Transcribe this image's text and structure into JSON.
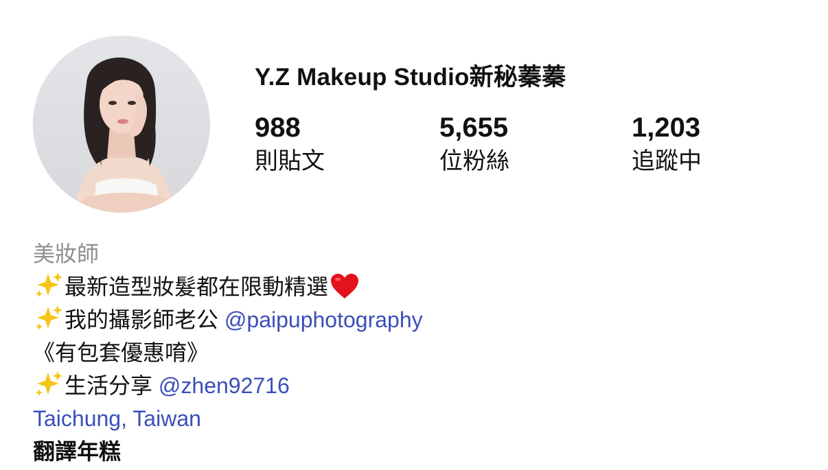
{
  "profile": {
    "username": "Y.Z Makeup Studio新秘蓁蓁",
    "avatar_icon": "profile-photo"
  },
  "stats": {
    "posts": {
      "count": "988",
      "label": "則貼文"
    },
    "followers": {
      "count": "5,655",
      "label": "位粉絲"
    },
    "following": {
      "count": "1,203",
      "label": "追蹤中"
    }
  },
  "bio": {
    "category": "美妝師",
    "line1": {
      "text": "最新造型妝髮都在限動精選",
      "icon": "sparkles-icon",
      "end_icon": "red-heart-icon"
    },
    "line2": {
      "text": "我的攝影師老公 ",
      "mention": "@paipuphotography",
      "icon": "sparkles-icon"
    },
    "line3": {
      "text": "《有包套優惠唷》"
    },
    "line4": {
      "text": "生活分享 ",
      "mention": "@zhen92716",
      "icon": "sparkles-icon"
    },
    "location": "Taichung, Taiwan",
    "translate": "翻譯年糕"
  },
  "colors": {
    "link": "#3a4fb8",
    "category": "#8e8e93",
    "heart": "#e3121b",
    "sparkle": "#f5c518"
  }
}
